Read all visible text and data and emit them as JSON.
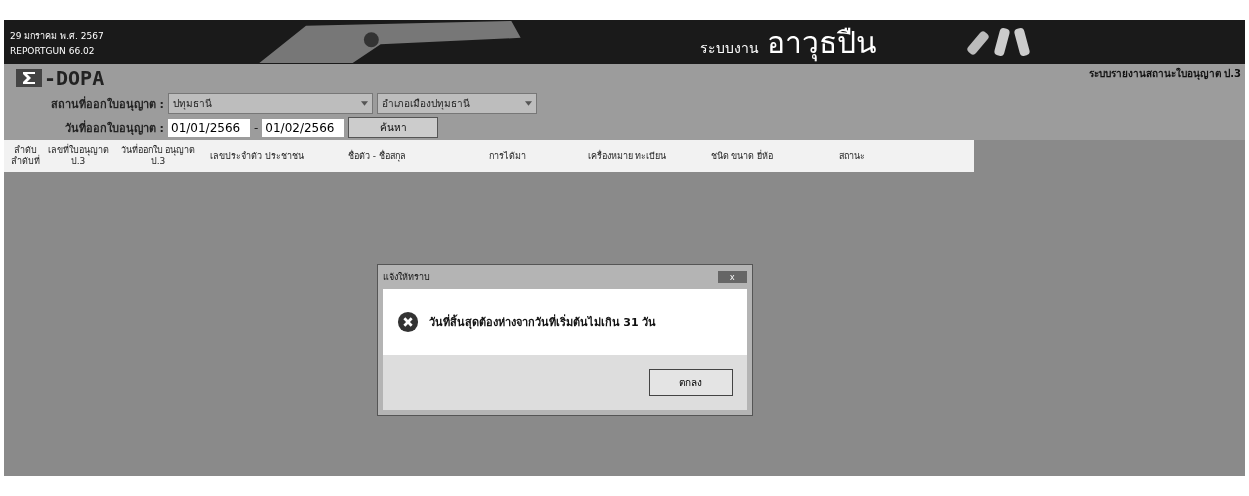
{
  "banner": {
    "date": "29 มกราคม พ.ศ. 2567",
    "report_code": "REPORTGUN 66.02",
    "system_title_prefix": "ระบบงาน",
    "system_title": "อาวุธปืน"
  },
  "logo": {
    "text": "-DOPA"
  },
  "report_title": "ระบบรายงานสถานะใบอนุญาต ป.3",
  "filters": {
    "place_label": "สถานที่ออกใบอนุญาต :",
    "province": "ปทุมธานี",
    "district": "อำเภอเมืองปทุมธานี",
    "date_label": "วันที่ออกใบอนุญาต :",
    "date_from": "01/01/2566",
    "date_separator": "-",
    "date_to": "01/02/2566",
    "search_button": "ค้นหา"
  },
  "table": {
    "columns": [
      "ลำดับ ลำดับที่",
      "เลขที่ใบอนุญาต ป.3",
      "วันที่ออกใบ อนุญาต ป.3",
      "เลขประจำตัว ประชาชน",
      "ชื่อตัว - ชื่อสกุล",
      "การได้มา",
      "เครื่องหมาย ทะเบียน",
      "ชนิด ขนาด ยี่ห้อ",
      "สถานะ"
    ]
  },
  "dialog": {
    "title": "แจ้งให้ทราบ",
    "close": "x",
    "message": "วันที่สิ้นสุดต้องห่างจากวันที่เริ่มต้นไม่เกิน 31 วัน",
    "button": "ตกลง"
  }
}
